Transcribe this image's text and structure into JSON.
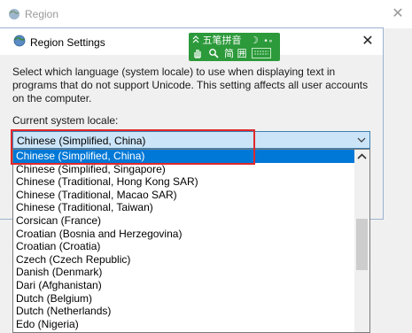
{
  "background_window": {
    "title": "Region",
    "close_glyph": "✕"
  },
  "dialog": {
    "title": "Region Settings",
    "close_glyph": "✕",
    "description": "Select which language (system locale) to use when displaying text in programs that do not support Unicode. This setting affects all user accounts on the computer.",
    "locale_label": "Current system locale:",
    "combo_value": "Chinese (Simplified, China)"
  },
  "dropdown": {
    "selected_index": 0,
    "items": [
      "Chinese (Simplified, China)",
      "Chinese (Simplified, Singapore)",
      "Chinese (Traditional, Hong Kong SAR)",
      "Chinese (Traditional, Macao SAR)",
      "Chinese (Traditional, Taiwan)",
      "Corsican (France)",
      "Croatian (Bosnia and Herzegovina)",
      "Croatian (Croatia)",
      "Czech (Czech Republic)",
      "Danish (Denmark)",
      "Dari (Afghanistan)",
      "Dutch (Belgium)",
      "Dutch (Netherlands)",
      "Edo (Nigeria)"
    ]
  },
  "ime_toolbar": {
    "top_text": "五笔拼音",
    "moon_glyph": "☽",
    "punct_glyph": "•∘",
    "bottom_text": "简 囲"
  },
  "colors": {
    "accent": "#0078d7",
    "highlight_box": "#e0282c",
    "ime_green": "#2c9a3a"
  }
}
